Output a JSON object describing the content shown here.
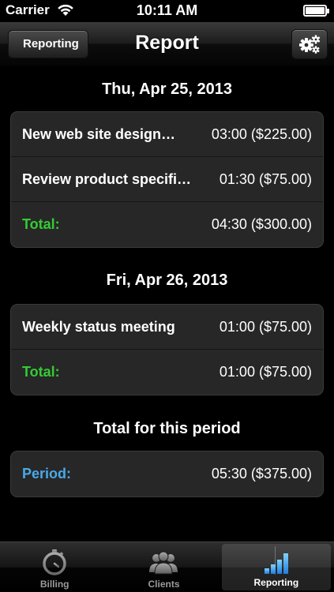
{
  "status_bar": {
    "carrier": "Carrier",
    "time": "10:11 AM"
  },
  "nav": {
    "back_label": "Reporting",
    "title": "Report",
    "settings_icon": "gear-icon"
  },
  "days": [
    {
      "date": "Thu, Apr 25, 2013",
      "entries": [
        {
          "name": "New web site design for...",
          "display": "New web site design…",
          "value": "03:00 ($225.00)"
        },
        {
          "name": "Review  product specifi…",
          "display": "Review  product specifi…",
          "value": "01:30 ($75.00)"
        }
      ],
      "total_label": "Total:",
      "total_value": "04:30 ($300.00)"
    },
    {
      "date": "Fri, Apr 26, 2013",
      "entries": [
        {
          "name": "Weekly status meeting",
          "display": "Weekly status meeting",
          "value": "01:00 ($75.00)"
        }
      ],
      "total_label": "Total:",
      "total_value": "01:00 ($75.00)"
    }
  ],
  "period": {
    "header": "Total for this period",
    "label": "Period:",
    "value": "05:30 ($375.00)"
  },
  "tabs": [
    {
      "label": "Billing",
      "icon": "stopwatch-icon",
      "selected": false
    },
    {
      "label": "Clients",
      "icon": "people-icon",
      "selected": false
    },
    {
      "label": "Reporting",
      "icon": "bar-chart-icon",
      "selected": true
    }
  ],
  "colors": {
    "total": "#33cc33",
    "period": "#4aa8e8",
    "cell_bg": "#272727"
  }
}
